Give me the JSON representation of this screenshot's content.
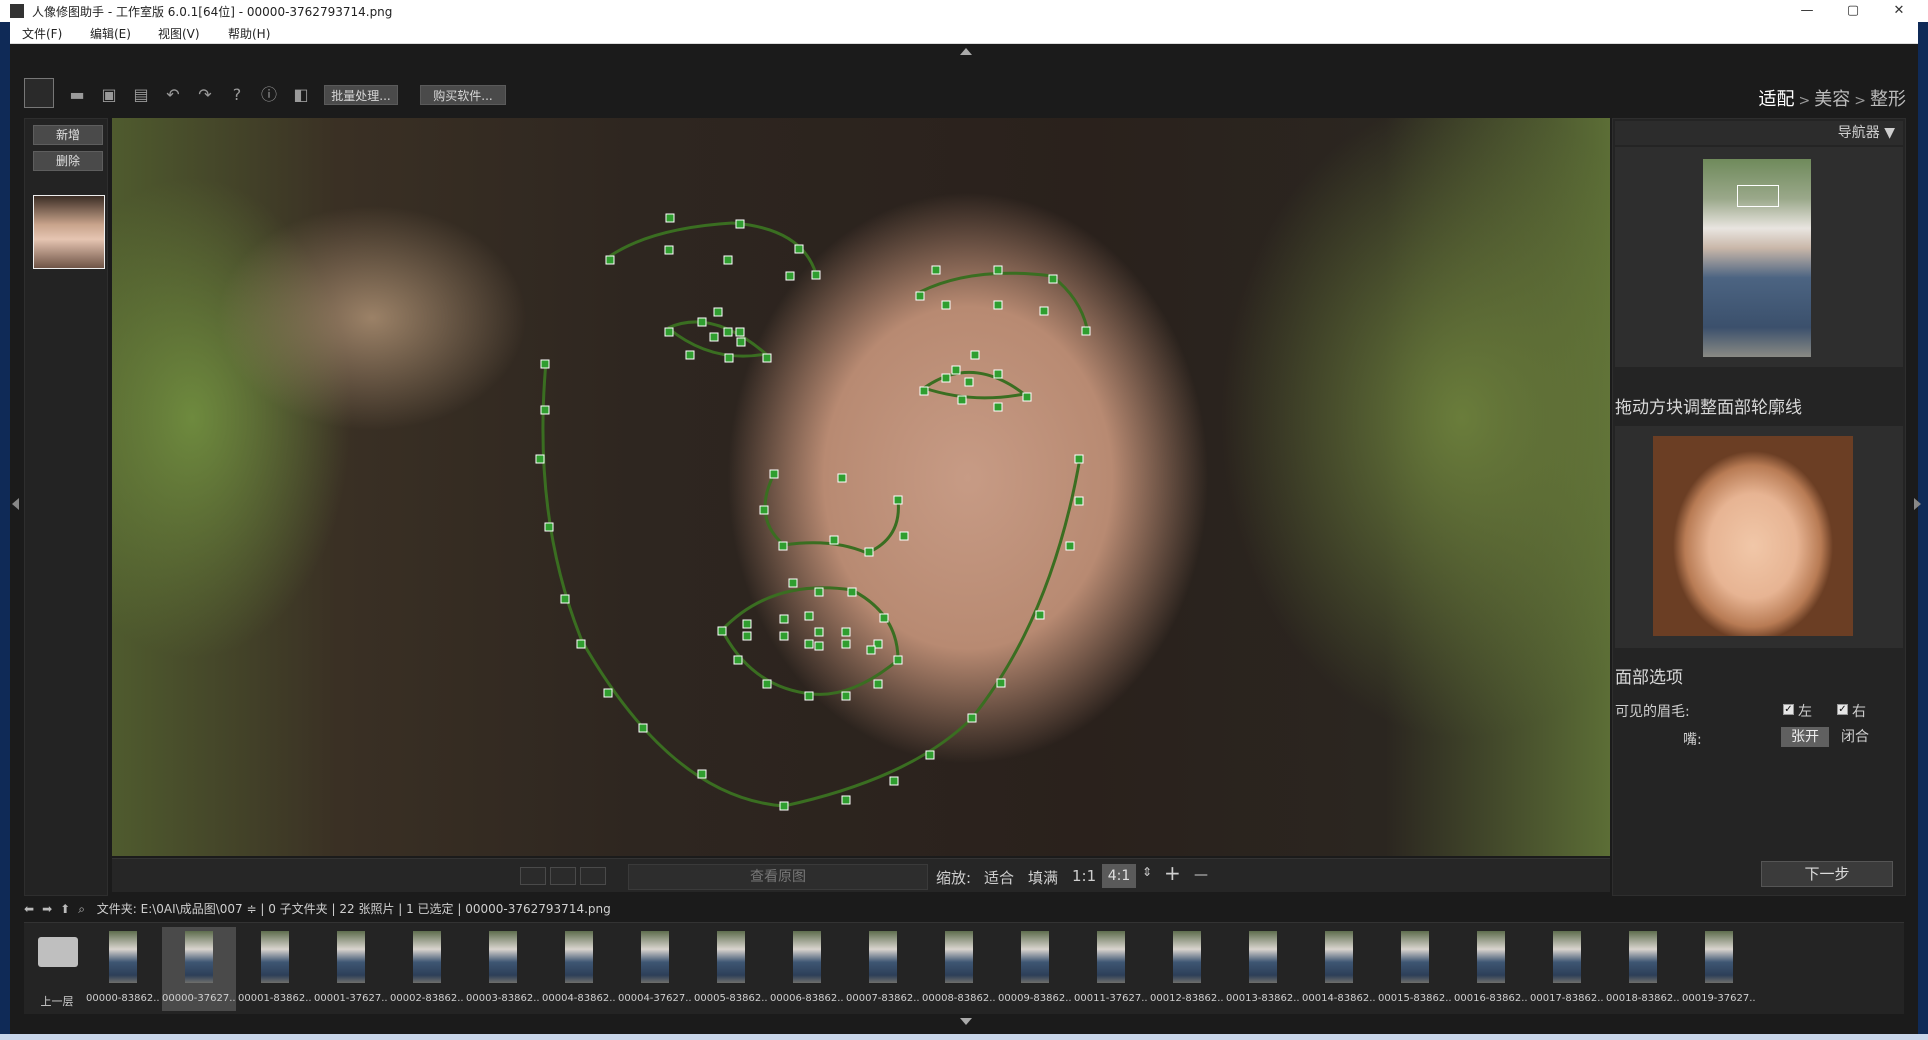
{
  "window": {
    "title": "人像修图助手 - 工作室版 6.0.1[64位] - 00000-3762793714.png",
    "min": "—",
    "max": "▢",
    "close": "✕"
  },
  "menu": [
    "文件(F)",
    "编辑(E)",
    "视图(V)",
    "帮助(H)"
  ],
  "toolbar": {
    "batch": "批量处理...",
    "buy": "购买软件...",
    "icons": [
      "open-folder-icon",
      "save-icon",
      "save-as-icon",
      "undo-icon",
      "redo-icon",
      "help-icon",
      "info-icon",
      "crop-icon"
    ]
  },
  "steps": {
    "step1": "适配",
    "step2": "美容",
    "step3": "整形",
    "sep": ">"
  },
  "left": {
    "add": "新增",
    "delete": "删除"
  },
  "canvasbar": {
    "view_original": "查看原图",
    "zoom_label": "缩放:",
    "fit": "适合",
    "fill": "填满",
    "one_to_one": "1:1",
    "zoom_value": "4:1",
    "plus": "+",
    "minus": "—"
  },
  "right": {
    "navigator": "导航器 ▼",
    "contour_title": "拖动方块调整面部轮廓线",
    "face_options": "面部选项",
    "visible_brows": "可见的眉毛:",
    "left": "左",
    "right": "右",
    "mouth": "嘴:",
    "open": "张开",
    "closed": "闭合",
    "next": "下一步"
  },
  "pathbar": {
    "folder_label": "文件夹:",
    "folder_path": "E:\\0AI\\成品图\\007 ≑",
    "info": "| 0 子文件夹 | 22 张照片 | 1 已选定 | 00000-3762793714.png"
  },
  "filmstrip": {
    "up": "上一层",
    "selected_index": 1,
    "files": [
      "00000-83862...",
      "00000-37627...",
      "00001-83862...",
      "00001-37627...",
      "00002-83862...",
      "00003-83862...",
      "00004-83862...",
      "00004-37627...",
      "00005-83862...",
      "00006-83862...",
      "00007-83862...",
      "00008-83862...",
      "00009-83862...",
      "00011-37627...",
      "00012-83862...",
      "00013-83862...",
      "00014-83862...",
      "00015-83862...",
      "00016-83862...",
      "00017-83862...",
      "00018-83862...",
      "00019-37627..."
    ]
  },
  "colors": {
    "landmark": "#2f9e2f",
    "contour": "#3a6e21"
  }
}
